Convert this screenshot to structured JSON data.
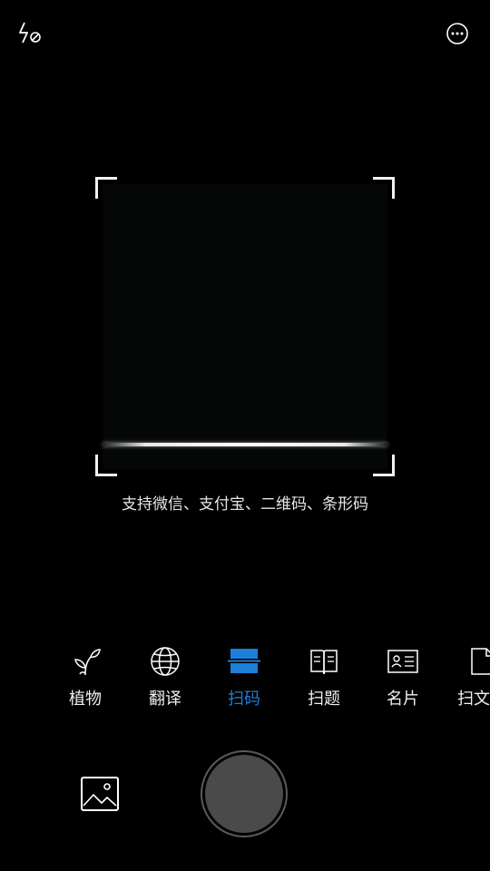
{
  "top_bar": {
    "flash_icon": "flash-off-icon",
    "more_icon": "more-icon"
  },
  "scanner": {
    "hint": "支持微信、支付宝、二维码、条形码"
  },
  "modes": [
    {
      "label": "植物",
      "icon": "plant-icon"
    },
    {
      "label": "翻译",
      "icon": "globe-icon"
    },
    {
      "label": "扫码",
      "icon": "scan-icon",
      "active": true
    },
    {
      "label": "扫题",
      "icon": "book-icon"
    },
    {
      "label": "名片",
      "icon": "card-icon"
    },
    {
      "label": "扫文",
      "icon": "document-icon"
    }
  ],
  "bottom_bar": {
    "gallery_icon": "gallery-icon"
  },
  "colors": {
    "active": "#1e7fd9",
    "background": "#000000"
  }
}
